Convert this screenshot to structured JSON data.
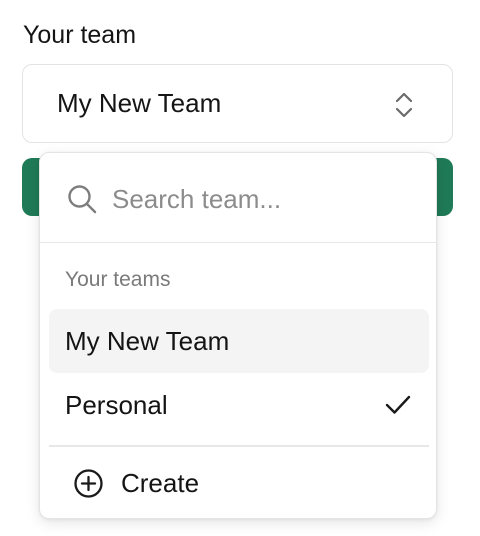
{
  "field": {
    "label": "Your team",
    "selected_value": "My New Team",
    "chevron_icon": "chevrons-up-down-icon"
  },
  "popover": {
    "search": {
      "placeholder": "Search team...",
      "value": "",
      "icon": "search-icon"
    },
    "group_heading": "Your teams",
    "options": [
      {
        "label": "My New Team",
        "highlighted": true,
        "selected": false
      },
      {
        "label": "Personal",
        "highlighted": false,
        "selected": true
      }
    ],
    "check_icon": "check-icon",
    "create": {
      "label": "Create",
      "icon": "plus-circle-icon"
    }
  },
  "colors": {
    "accent_green": "#1f7a57",
    "highlight_bg": "#f4f4f4",
    "muted_text": "#7a7a7a"
  }
}
